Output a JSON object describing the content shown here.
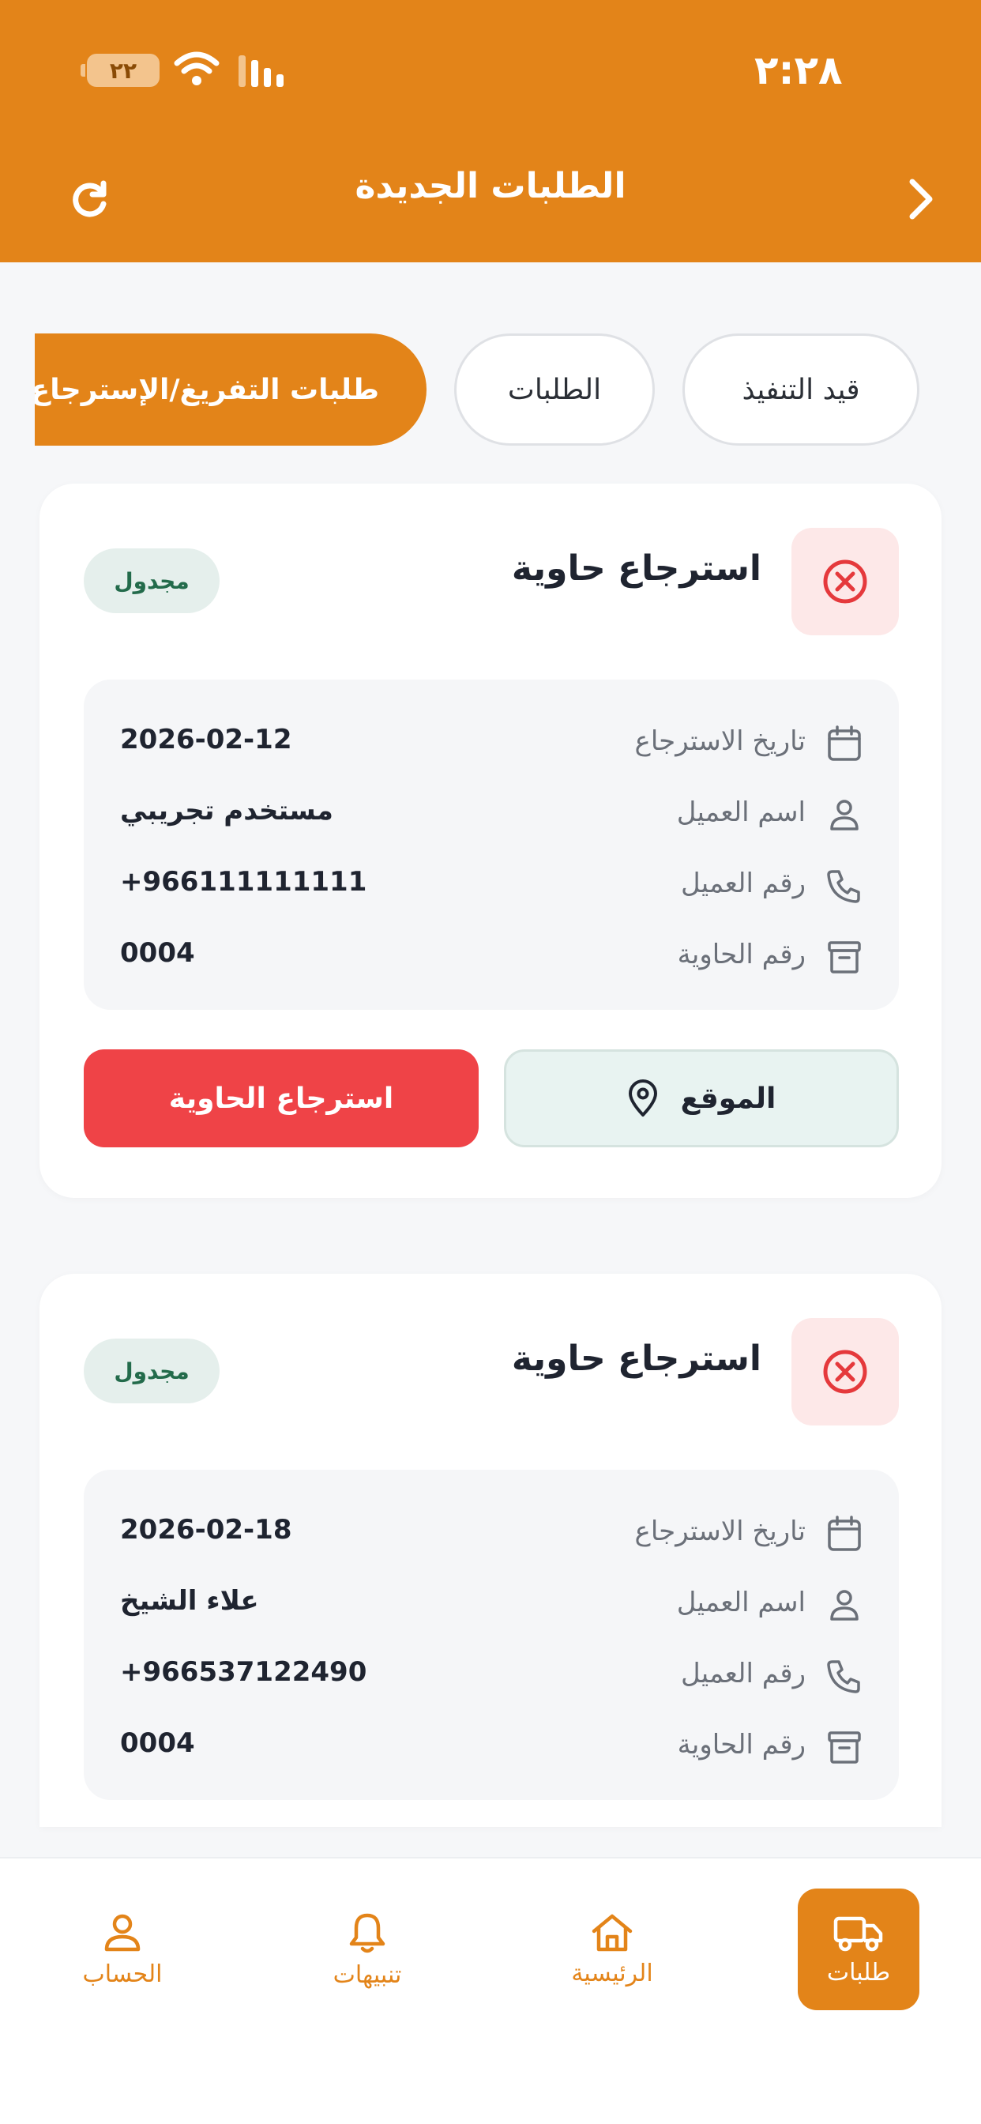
{
  "status_bar": {
    "time": "٢:٢٨",
    "battery": "٢٢"
  },
  "header": {
    "title": "الطلبات الجديدة"
  },
  "tabs": [
    {
      "label": "قيد التنفيذ"
    },
    {
      "label": "الطلبات"
    },
    {
      "label": "طلبات التفريغ/الإسترجاع"
    }
  ],
  "orders": [
    {
      "title": "استرجاع حاوية",
      "status": "مجدول",
      "details": {
        "date_label": "تاريخ الاسترجاع",
        "date": "2026-02-12",
        "name_label": "اسم العميل",
        "name": "مستخدم تجريبي",
        "phone_label": "رقم العميل",
        "phone": "+966111111111",
        "container_label": "رقم الحاوية",
        "container": "0004"
      },
      "location_label": "الموقع",
      "retrieve_label": "استرجاع الحاوية"
    },
    {
      "title": "استرجاع حاوية",
      "status": "مجدول",
      "details": {
        "date_label": "تاريخ الاسترجاع",
        "date": "2026-02-18",
        "name_label": "اسم العميل",
        "name": "علاء الشيخ",
        "phone_label": "رقم العميل",
        "phone": "+966537122490",
        "container_label": "رقم الحاوية",
        "container": "0004"
      }
    }
  ],
  "bottom_nav": [
    {
      "label": "طلبات",
      "icon": "truck-icon",
      "active": true
    },
    {
      "label": "الرئيسية",
      "icon": "home-icon"
    },
    {
      "label": "تنبيهات",
      "icon": "bell-icon"
    },
    {
      "label": "الحساب",
      "icon": "user-icon"
    }
  ],
  "colors": {
    "primary": "#e38419",
    "danger": "#ef4347",
    "badge_bg": "#e5efec",
    "badge_text": "#236b4b"
  }
}
